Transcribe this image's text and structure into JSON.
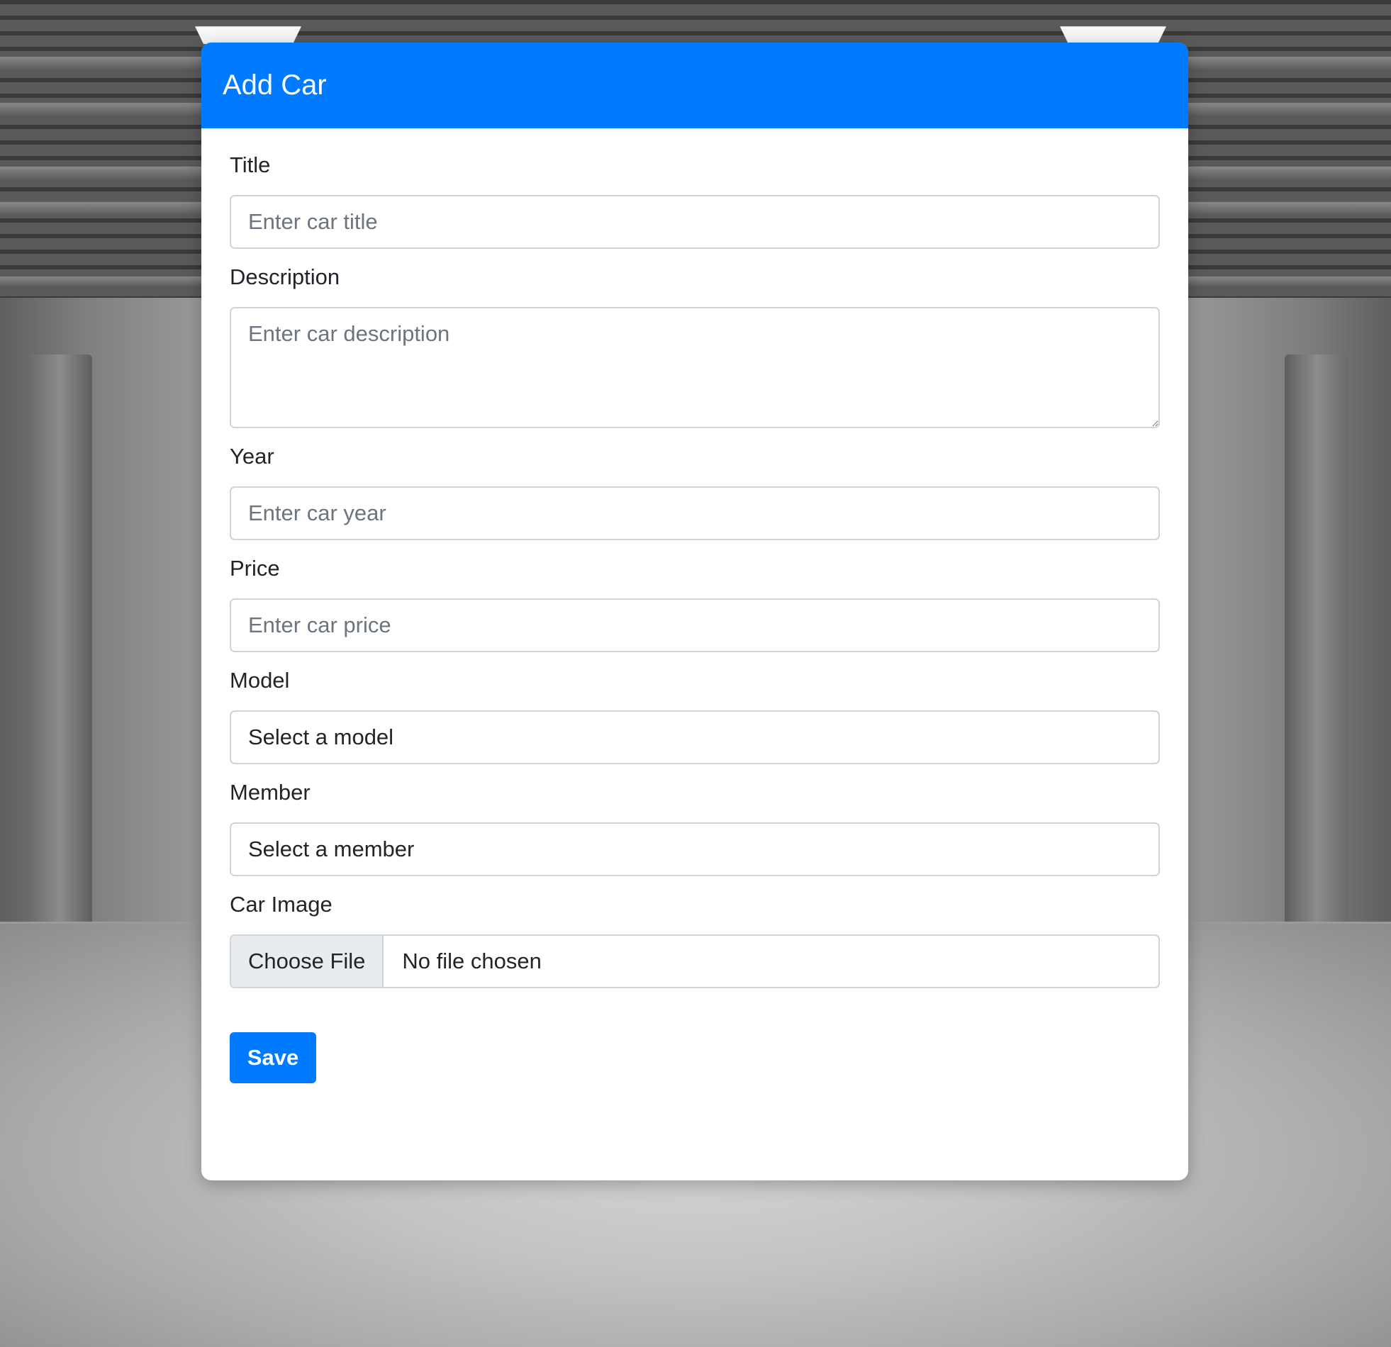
{
  "form": {
    "title": "Add Car",
    "fields": {
      "title": {
        "label": "Title",
        "placeholder": "Enter car title"
      },
      "description": {
        "label": "Description",
        "placeholder": "Enter car description"
      },
      "year": {
        "label": "Year",
        "placeholder": "Enter car year"
      },
      "price": {
        "label": "Price",
        "placeholder": "Enter car price"
      },
      "model": {
        "label": "Model",
        "selected": "Select a model"
      },
      "member": {
        "label": "Member",
        "selected": "Select a member"
      },
      "image": {
        "label": "Car Image",
        "button_label": "Choose File",
        "status": "No file chosen"
      }
    },
    "save_label": "Save"
  },
  "colors": {
    "primary": "#007bff",
    "card_background": "#ffffff",
    "input_border": "#ced4da",
    "placeholder": "#6c757d",
    "file_button_background": "#e9ecef"
  },
  "background": {
    "image": "garage-interior-grayscale"
  }
}
